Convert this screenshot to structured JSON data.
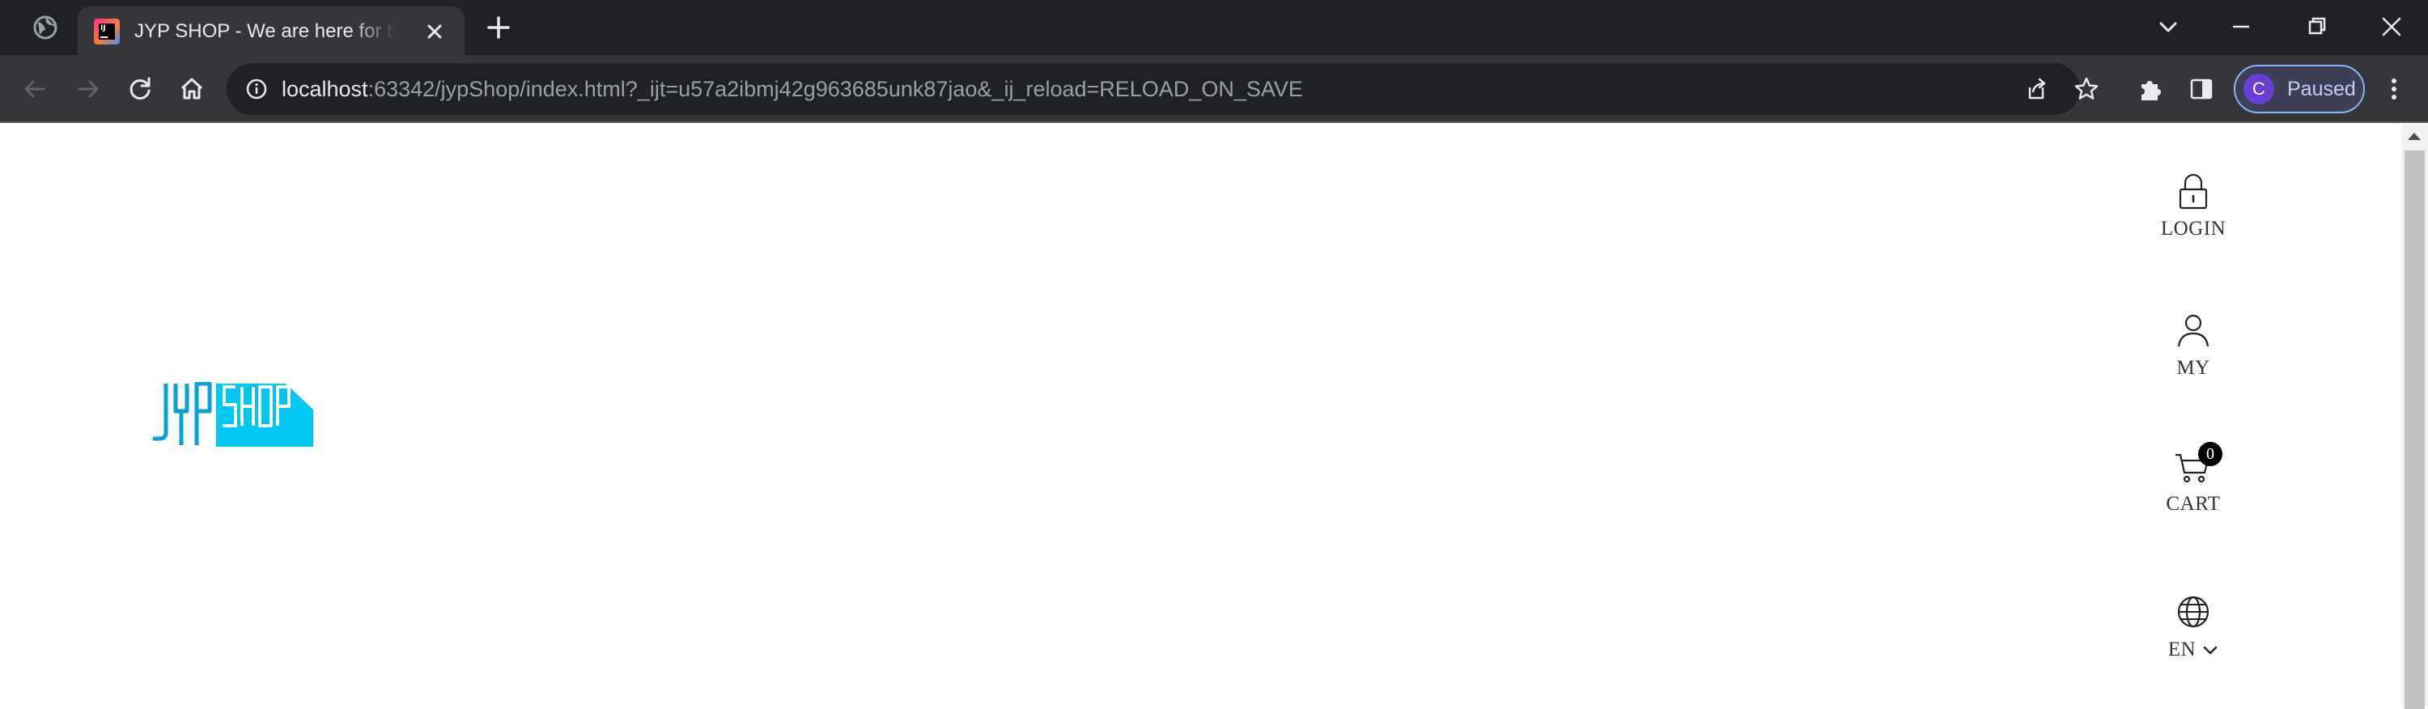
{
  "browser": {
    "tab": {
      "title": "JYP SHOP - We are here for the fans"
    },
    "address_bar": {
      "host": "localhost",
      "path": ":63342/jypShop/index.html?_ijt=u57a2ibmj42g963685unk87jao&_ij_reload=RELOAD_ON_SAVE"
    },
    "profile": {
      "initial": "C",
      "status": "Paused"
    }
  },
  "site": {
    "logo_text": "JYP SHOP",
    "utility_nav": {
      "login": "LOGIN",
      "my": "MY",
      "cart": "CART",
      "cart_count": "0",
      "language": "EN"
    }
  },
  "colors": {
    "logo_cyan": "#00c8f0",
    "chrome_dark": "#202124",
    "chrome_toolbar": "#35363a"
  }
}
